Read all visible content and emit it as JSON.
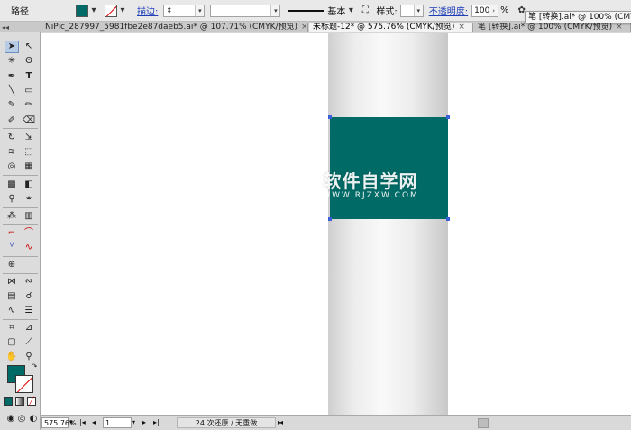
{
  "control_bar": {
    "path_label": "路径",
    "fill_color": "#006a66",
    "stroke_label": "描边:",
    "stroke_preset": "基本",
    "style_label": "样式:",
    "opacity_label": "不透明度:",
    "opacity_value": "100",
    "opacity_unit": "%"
  },
  "doc_tooltip": "笔 [转换].ai* @ 100% (CMYK/预览)",
  "tabs": [
    {
      "label": "NiPic_287997_5981fbe2e87daeb5.ai* @ 107.71% (CMYK/预览)",
      "active": false
    },
    {
      "label": "未标题-12* @ 575.76% (CMYK/预览)",
      "active": true
    },
    {
      "label": "笔 [转换].ai* @ 100% (CMYK/预览)",
      "active": false
    }
  ],
  "tab_close": "×",
  "canvas": {
    "pillar_color": "#ececec",
    "square_color": "#006a66",
    "anchor_color": "#3b5fd6"
  },
  "watermark": {
    "title": "软件自学网",
    "url": "WWW.RJZXW.COM"
  },
  "status_bar": {
    "zoom": "575.76%",
    "artboard": "1",
    "history": "24 次还原 / 无重做"
  },
  "tools_panel": {
    "fill_color": "#006a66",
    "stroke": "none"
  }
}
